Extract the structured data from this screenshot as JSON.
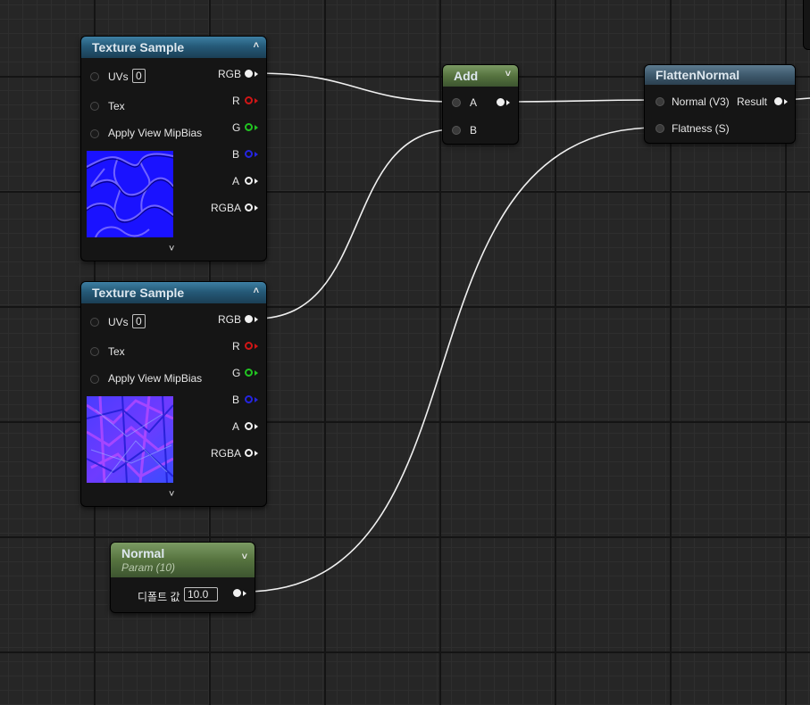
{
  "texture_sample_1": {
    "title": "Texture Sample",
    "inputs": [
      "UVs",
      "Tex",
      "Apply View MipBias"
    ],
    "uvs_value": "0",
    "outputs": [
      "RGB",
      "R",
      "G",
      "B",
      "A",
      "RGBA"
    ]
  },
  "texture_sample_2": {
    "title": "Texture Sample",
    "inputs": [
      "UVs",
      "Tex",
      "Apply View MipBias"
    ],
    "uvs_value": "0",
    "outputs": [
      "RGB",
      "R",
      "G",
      "B",
      "A",
      "RGBA"
    ]
  },
  "add_node": {
    "title": "Add",
    "inputs": [
      "A",
      "B"
    ]
  },
  "flatten_normal": {
    "title": "FlattenNormal",
    "inputs": [
      "Normal (V3)",
      "Flatness (S)"
    ],
    "output": "Result"
  },
  "normal_param": {
    "title": "Normal",
    "subtitle": "Param (10)",
    "default_label": "디폴트 값",
    "default_value": "10.0"
  },
  "colors": {
    "texture_header": "#255a78",
    "add_header": "#56733f",
    "param_header": "#56733f",
    "function_header": "#3f5a6d",
    "pin_red": "#d01616",
    "pin_green": "#22c422",
    "pin_blue": "#2525e0",
    "wire": "#f0f0f0"
  }
}
